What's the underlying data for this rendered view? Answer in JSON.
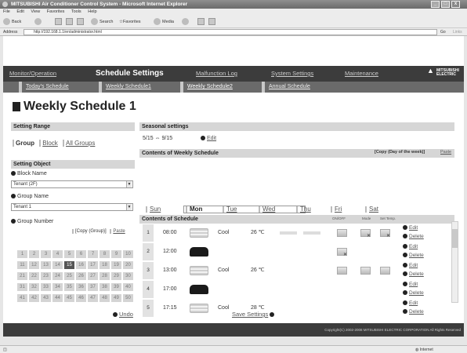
{
  "window": {
    "title": "MITSUBISHI Air Conditioner Control System - Microsoft Internet Explorer",
    "minimize_label": "_",
    "maximize_label": "□",
    "close_label": "x"
  },
  "browser": {
    "menu": [
      "File",
      "Edit",
      "View",
      "Favorites",
      "Tools",
      "Help"
    ],
    "back_label": "Back",
    "search_label": "Search",
    "favorites_label": "Favorites",
    "media_label": "Media",
    "address_label": "Address",
    "address_value": "http://192.168.1.1/en/administrator.html",
    "go_label": "Go",
    "links_label": "Links",
    "status_zone": "Internet"
  },
  "nav": {
    "items": [
      "Monitor/Operation",
      "Schedule Settings",
      "Malfunction Log",
      "System Settings",
      "Maintenance"
    ],
    "active_index": 1,
    "brand": [
      "MITSUBISHI",
      "ELECTRIC"
    ]
  },
  "subnav": {
    "items": [
      "Today's Schedule",
      "Weekly Schedule1",
      "Weekly Schedule2",
      "Annual Schedule"
    ]
  },
  "page_title": "Weekly Schedule 1",
  "setting_range": {
    "heading": "Setting Range",
    "options": [
      "Group",
      "Block",
      "All Groups"
    ]
  },
  "setting_object": {
    "heading": "Setting Object",
    "block_name_label": "Block Name",
    "block_name_value": "Tenant (2F)",
    "group_name_label": "Group Name",
    "group_name_value": "Tenant 1",
    "group_number_label": "Group Number",
    "copy_group_label": "[Copy (Group)]",
    "paste_label": "Paste",
    "numbers": [
      1,
      2,
      3,
      4,
      5,
      6,
      7,
      8,
      9,
      10,
      11,
      12,
      13,
      14,
      15,
      16,
      17,
      18,
      19,
      20,
      21,
      22,
      23,
      24,
      25,
      26,
      27,
      28,
      29,
      30,
      31,
      32,
      33,
      34,
      35,
      36,
      37,
      38,
      39,
      40,
      41,
      42,
      43,
      44,
      45,
      46,
      47,
      48,
      49,
      50
    ],
    "highlighted": 15
  },
  "seasonal": {
    "heading": "Seasonal settings",
    "range": "5/15 ⇔ 9/15",
    "edit_label": "Edit"
  },
  "weekly": {
    "heading": "Contents of Weekly Schedule",
    "copy_label": "[Copy (Day of the week)]",
    "paste_label": "Paste",
    "days": [
      "Sun",
      "Mon",
      "Tue",
      "Wed",
      "Thu",
      "Fri",
      "Sat"
    ],
    "selected_day": "Mon"
  },
  "schedule": {
    "heading": "Contents of Schedule",
    "col_onoff": "ON/OFF",
    "col_mode": "Mode",
    "col_settemp": "Set Temp.",
    "edit_label": "Edit",
    "delete_label": "Delete",
    "rows": [
      {
        "no": "1",
        "time": "08:00",
        "mode": "Cool",
        "temp": "26 ℃"
      },
      {
        "no": "2",
        "time": "12:00",
        "mode": "",
        "temp": ""
      },
      {
        "no": "3",
        "time": "13:00",
        "mode": "Cool",
        "temp": "26 ℃"
      },
      {
        "no": "4",
        "time": "17:00",
        "mode": "",
        "temp": ""
      },
      {
        "no": "5",
        "time": "17:15",
        "mode": "Cool",
        "temp": "28 ℃"
      }
    ]
  },
  "bottom": {
    "undo_label": "Undo",
    "save_label": "Save Settings"
  },
  "footer": {
    "copyright": "Copyright(C) 2002-2008 MITSUBISHI ELECTRIC CORPORATION All Rights Reserved"
  }
}
